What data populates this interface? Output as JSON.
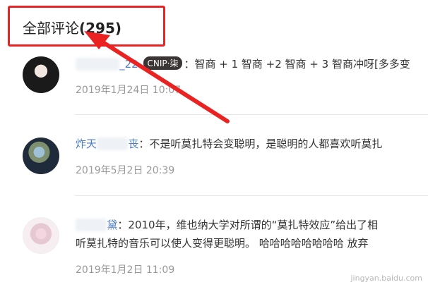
{
  "header": {
    "title": "全部评论",
    "count": "(295)"
  },
  "comments": [
    {
      "username_visible": "_22",
      "badge": "CNIP·柒",
      "text": "：智商 + 1 智商 +2 智商 + 3 智商冲呀[多多变",
      "time": "2019年1月24日 10:07"
    },
    {
      "username_visible": "炸天",
      "username_suffix": "丧",
      "text": "：不是听莫扎特会变聪明，是聪明的人都喜欢听莫扎",
      "time": "2019年5月2日 20:39"
    },
    {
      "username_visible": "黛",
      "text": "：2010年，维也纳大学对所谓的“莫扎特效应”给出了相",
      "text_line2": "听莫扎特的音乐可以使人变得更聪明。 哈哈哈哈哈哈哈哈 放弃",
      "time": "2019年1月2日 11:09"
    }
  ],
  "watermark": "jingyan.baidu.com",
  "colors": {
    "annotation_red": "#ea2222",
    "username_blue": "#4a7cc7"
  }
}
